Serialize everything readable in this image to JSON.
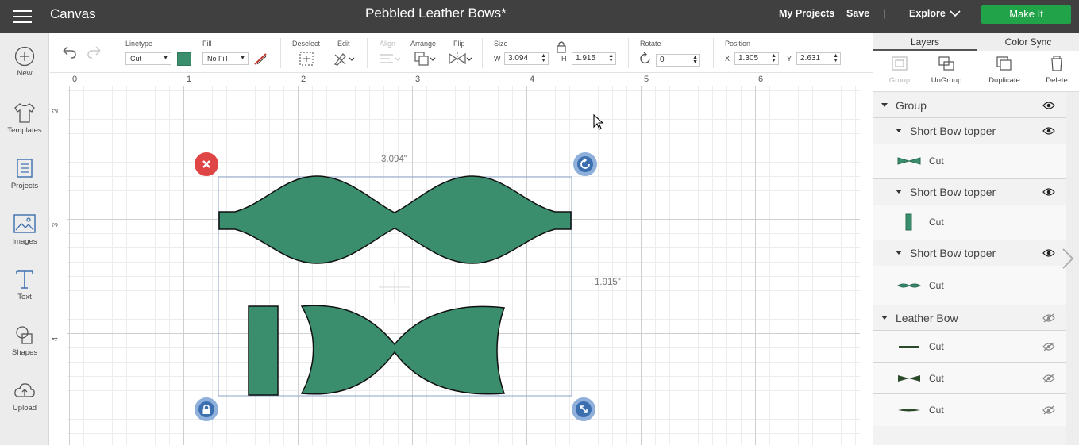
{
  "topbar": {
    "app_title": "Canvas",
    "project_title": "Pebbled Leather Bows*",
    "my_projects": "My Projects",
    "save": "Save",
    "separator": "|",
    "explore": "Explore",
    "make_it": "Make It",
    "make_it_color": "#21a34a"
  },
  "leftbar": {
    "items": [
      {
        "label": "New",
        "icon": "plus-circle-icon"
      },
      {
        "label": "Templates",
        "icon": "shirt-icon"
      },
      {
        "label": "Projects",
        "icon": "projects-icon"
      },
      {
        "label": "Images",
        "icon": "image-icon"
      },
      {
        "label": "Text",
        "icon": "text-icon"
      },
      {
        "label": "Shapes",
        "icon": "shapes-icon"
      },
      {
        "label": "Upload",
        "icon": "upload-cloud-icon"
      }
    ]
  },
  "toolbar": {
    "linetype_label": "Linetype",
    "linetype_value": "Cut",
    "fill_label": "Fill",
    "fill_value": "No Fill",
    "deselect_label": "Deselect",
    "edit_label": "Edit",
    "align_label": "Align",
    "arrange_label": "Arrange",
    "flip_label": "Flip",
    "size_label": "Size",
    "w_label": "W",
    "w_value": "3.094",
    "h_label": "H",
    "h_value": "1.915",
    "rotate_label": "Rotate",
    "rotate_value": "0",
    "position_label": "Position",
    "x_label": "X",
    "x_value": "1.305",
    "y_label": "Y",
    "y_value": "2.631",
    "swatch_color": "#3a8e6d"
  },
  "canvas": {
    "ruler_top": [
      "0",
      "1",
      "2",
      "3",
      "4",
      "5",
      "6"
    ],
    "ruler_left": [
      "2",
      "3",
      "4"
    ],
    "width_dim": "3.094\"",
    "height_dim": "1.915\"",
    "shape_color": "#3a8e6d"
  },
  "rpanel": {
    "tabs": [
      "Layers",
      "Color Sync"
    ],
    "actions": [
      "Group",
      "UnGroup",
      "Duplicate",
      "Delete"
    ],
    "layers": {
      "group": "Group",
      "sub1": "Short Bow topper",
      "cut": "Cut",
      "sub2": "Short Bow topper",
      "sub3": "Short Bow topper",
      "leather": "Leather Bow"
    }
  }
}
